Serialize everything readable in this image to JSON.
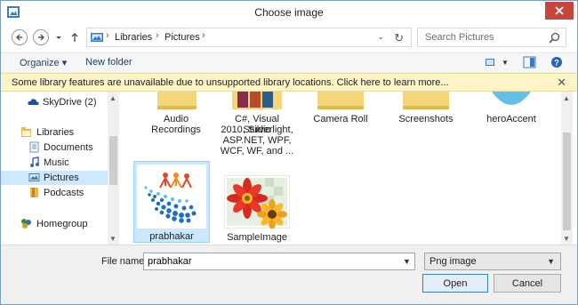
{
  "window": {
    "title": "Choose image"
  },
  "address": {
    "crumbs": [
      "Libraries",
      "Pictures"
    ],
    "search_placeholder": "Search Pictures"
  },
  "toolbar": {
    "organize": "Organize",
    "new_folder": "New folder"
  },
  "infobar": {
    "message": "Some library features are unavailable due to unsupported library locations. Click here to learn more..."
  },
  "nav": {
    "skydrive": "SkyDrive (2)",
    "libraries": "Libraries",
    "documents": "Documents",
    "music": "Music",
    "pictures": "Pictures",
    "podcasts": "Podcasts",
    "homegroup": "Homegroup"
  },
  "files": {
    "audio": [
      "Audio",
      "Recordings"
    ],
    "csharp": [
      "C#, Visual Studio",
      "2010, Silverlight,",
      "ASP.NET, WPF,",
      "WCF, WF, and ..."
    ],
    "camera": "Camera Roll",
    "screenshots": "Screenshots",
    "hero": "heroAccent",
    "prabhakar": "prabhakar",
    "sample": "SampleImage"
  },
  "footer": {
    "file_name_label": "File name:",
    "file_name_value": "prabhakar",
    "file_type": "Png image",
    "open": "Open",
    "cancel": "Cancel"
  },
  "colors": {
    "accent": "#cce8ff",
    "close": "#c7453c",
    "info": "#fdf5c8"
  }
}
